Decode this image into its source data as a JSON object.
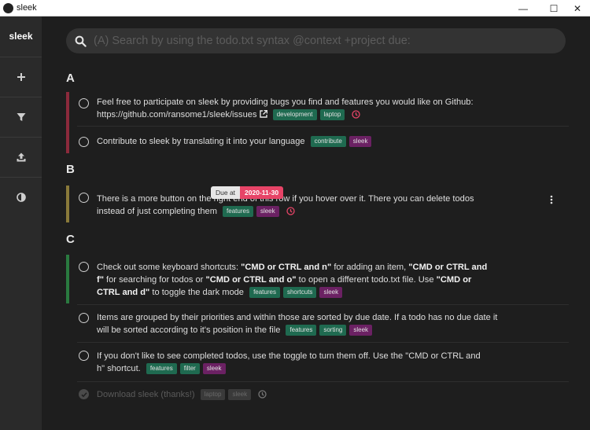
{
  "window": {
    "title": "sleek",
    "minimize": "—",
    "maximize": "☐",
    "close": "✕"
  },
  "sidebar": {
    "brand": "sleek",
    "items": [
      {
        "name": "add-todo-button",
        "icon": "plus-icon"
      },
      {
        "name": "filter-button",
        "icon": "filter-icon"
      },
      {
        "name": "open-file-button",
        "icon": "upload-icon"
      },
      {
        "name": "theme-toggle-button",
        "icon": "contrast-icon"
      }
    ]
  },
  "search": {
    "placeholder": "(A) Search by using the todo.txt syntax @context +project due:"
  },
  "colors": {
    "priorityA": "#8c2a3c",
    "priorityB": "#8a7a3a",
    "priorityC": "#2a7a40",
    "tagGreen": "#1f6a50",
    "tagPurple": "#6b2163",
    "dueRed": "#e74467"
  },
  "groups": [
    {
      "label": "A",
      "todos": [
        {
          "text": "Feel free to participate on sleek by providing bugs you find and features you would like on Github:",
          "url": "https://github.com/ransome1/sleek/issues",
          "tags": [
            "development",
            "laptop"
          ],
          "due": true
        },
        {
          "text": "Contribute to sleek by translating it into your language",
          "tags": [
            "contribute",
            "sleek"
          ]
        }
      ]
    },
    {
      "label": "B",
      "todos": [
        {
          "text": "There is a more button on the right end of this row if you hover over it. There you can delete todos instead of just completing them",
          "tags": [
            "features",
            "sleek"
          ],
          "due": true,
          "tooltip": {
            "label": "Due at",
            "date": "2020-11-30"
          }
        }
      ]
    },
    {
      "label": "C",
      "todos": [
        {
          "parts": [
            "Check out some keyboard shortcuts: ",
            "\"CMD or CTRL and n\"",
            " for adding an item, ",
            "\"CMD or CTRL and f\"",
            " for searching for todos or ",
            "\"CMD or CTRL and o\"",
            " to open a different todo.txt file. Use ",
            "\"CMD or CTRL and d\"",
            " to toggle the dark mode"
          ],
          "tags": [
            "features",
            "shortcuts",
            "sleek"
          ]
        },
        {
          "text": "Items are grouped by their priorities and within those are sorted by due date. If a todo has no due date it will be sorted according to it's position in the file",
          "tags": [
            "features",
            "sorting",
            "sleek"
          ]
        },
        {
          "text": "If you don't like to see completed todos, use the toggle to turn them off. Use the \"CMD or CTRL and h\" shortcut.",
          "tags": [
            "features",
            "filter",
            "sleek"
          ]
        },
        {
          "text": "Download sleek (thanks!)",
          "tags": [
            "laptop",
            "sleek"
          ],
          "completed": true,
          "due": true
        }
      ]
    }
  ]
}
